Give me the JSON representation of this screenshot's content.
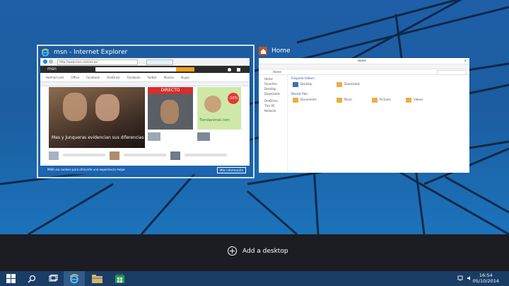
{
  "windows": [
    {
      "title": "msn - Internet Explorer",
      "app": "internet-explorer",
      "selected": true,
      "content": {
        "address": "http://www.msn.com/es-es/",
        "logo": "msn",
        "headline": "Mas y Junqueras evidencian sus diferencias",
        "badge": "DIRECTO",
        "ad_text": "-10%",
        "ad_brand": "Tiendanimal.com",
        "nav_links": [
          "Hotmail.com",
          "Office",
          "Facebook",
          "OneDrive",
          "Facebook",
          "Twitter",
          "Música",
          "Skype"
        ],
        "notification": "MSN usa cookies para ofrecerte una experiencia mejor.",
        "notification_button": "Más información"
      }
    },
    {
      "title": "Home",
      "app": "file-explorer",
      "selected": false,
      "content": {
        "window_title": "Home",
        "breadcrumb": "Home",
        "nav_items": [
          "Home",
          "Favorites",
          "Desktop",
          "Downloads",
          "OneDrive",
          "This PC",
          "Network"
        ],
        "section_frequent": "Frequent folders",
        "section_recent": "Recent files",
        "folders": [
          "Desktop",
          "Downloads",
          "Documents",
          "Music",
          "Pictures",
          "Videos"
        ]
      }
    }
  ],
  "add_desktop_label": "Add a desktop",
  "taskbar": {
    "buttons": [
      "start",
      "search",
      "task-view",
      "internet-explorer",
      "file-explorer",
      "store"
    ],
    "active": "internet-explorer",
    "time": "16:54",
    "date": "05/10/2014"
  },
  "colors": {
    "desktop": "#1f5fa8",
    "taskbar": "#1a3d66",
    "vd_bar": "#1c1d22",
    "selection": "#c9e2ff",
    "ie_blue": "#1e88e5",
    "explorer_tan": "#e8b04a"
  }
}
